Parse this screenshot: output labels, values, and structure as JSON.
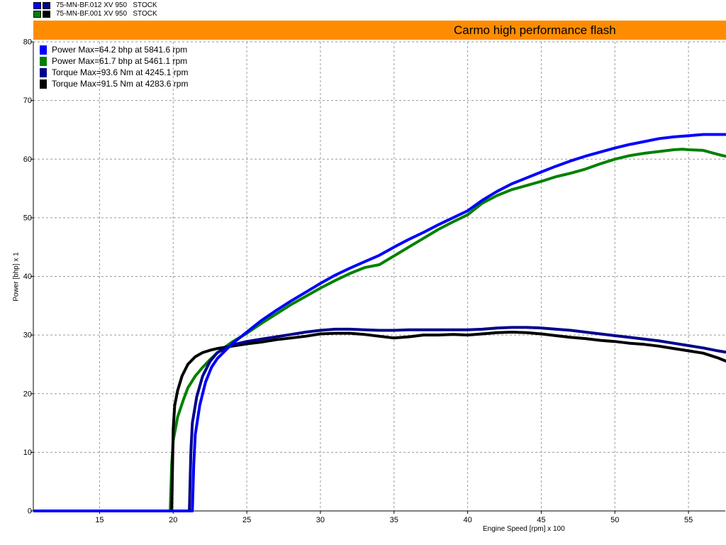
{
  "header": {
    "files": [
      {
        "label": "75-MN-BF.012 XV 950   STOCK",
        "color1": "#0000ff",
        "color2": "#00008b"
      },
      {
        "label": "75-MN-BF.001 XV 950   STOCK",
        "color1": "#008000",
        "color2": "#000000"
      }
    ],
    "banner_color": "#ff8c00"
  },
  "chart_data": {
    "type": "line",
    "title": "Carmo high performance flash",
    "xlabel": "Engine Speed [rpm] x 100",
    "ylabel": "Power [bhp] x 1",
    "xlim": [
      10.5,
      57.5
    ],
    "ylim": [
      0,
      80
    ],
    "x_ticks": [
      15,
      20,
      25,
      30,
      35,
      40,
      45,
      50,
      55
    ],
    "y_ticks": [
      0,
      10,
      20,
      30,
      40,
      50,
      60,
      70,
      80
    ],
    "grid": true,
    "legend_position": "top-left",
    "series": [
      {
        "name": "Power  Max=64.2 bhp at 5841.6 rpm",
        "color": "#0000ff",
        "x": [
          10.5,
          21.3,
          21.4,
          21.5,
          21.8,
          22.2,
          22.6,
          23,
          24,
          25,
          26,
          27,
          28,
          29,
          30,
          31,
          32,
          33,
          34,
          35,
          36,
          37,
          38,
          39,
          40,
          41,
          42,
          43,
          44,
          45,
          46,
          47,
          48,
          49,
          50,
          51,
          52,
          53,
          54,
          55,
          56,
          57,
          57.5
        ],
        "y": [
          0,
          0,
          8,
          13,
          18,
          22,
          24.5,
          26,
          28.5,
          30.5,
          32.5,
          34.2,
          35.8,
          37.3,
          38.8,
          40.2,
          41.4,
          42.5,
          43.6,
          45,
          46.3,
          47.5,
          48.8,
          50,
          51.2,
          53,
          54.5,
          55.8,
          56.8,
          57.8,
          58.8,
          59.7,
          60.5,
          61.2,
          61.9,
          62.5,
          63,
          63.5,
          63.8,
          64,
          64.2,
          64.2,
          64.2
        ]
      },
      {
        "name": "Power  Max=61.7 bhp at 5461.1 rpm",
        "color": "#008000",
        "x": [
          10.5,
          19.8,
          19.9,
          20,
          20.3,
          20.7,
          21,
          21.5,
          22,
          22.5,
          23,
          24,
          25,
          26,
          27,
          28,
          29,
          30,
          31,
          32,
          33,
          34,
          35,
          36,
          37,
          38,
          39,
          40,
          41,
          42,
          43,
          44,
          45,
          46,
          47,
          48,
          49,
          50,
          51,
          52,
          53,
          54,
          54.6,
          55,
          56,
          57,
          57.5
        ],
        "y": [
          0,
          0,
          8,
          12,
          16,
          19,
          21,
          23,
          24.5,
          25.8,
          27,
          28.8,
          30.3,
          32,
          33.6,
          35.2,
          36.6,
          38,
          39.3,
          40.5,
          41.5,
          42,
          43.5,
          45,
          46.5,
          48,
          49.3,
          50.5,
          52.5,
          53.8,
          54.8,
          55.5,
          56.2,
          57,
          57.6,
          58.3,
          59.2,
          60,
          60.6,
          61,
          61.3,
          61.6,
          61.7,
          61.6,
          61.5,
          60.8,
          60.5
        ]
      },
      {
        "name": "Torque  Max=93.6 Nm at 4245.1 rpm",
        "color": "#00008b",
        "x": [
          10.5,
          21.1,
          21.2,
          21.3,
          21.6,
          22,
          22.5,
          23,
          24,
          25,
          26,
          27,
          28,
          29,
          30,
          31,
          32,
          33,
          34,
          35,
          36,
          37,
          38,
          39,
          40,
          41,
          42,
          43,
          44,
          45,
          46,
          47,
          48,
          49,
          50,
          51,
          52,
          53,
          54,
          55,
          56,
          57,
          57.5
        ],
        "y": [
          0,
          0,
          10,
          15,
          19.5,
          23,
          25.5,
          27,
          28.3,
          28.9,
          29.3,
          29.7,
          30.1,
          30.5,
          30.8,
          31,
          31,
          30.9,
          30.8,
          30.8,
          30.9,
          30.9,
          30.9,
          30.9,
          30.9,
          31,
          31.2,
          31.3,
          31.3,
          31.2,
          31,
          30.8,
          30.5,
          30.2,
          29.9,
          29.6,
          29.3,
          29,
          28.6,
          28.2,
          27.8,
          27.3,
          27.1
        ]
      },
      {
        "name": "Torque  Max=91.5 Nm at 4283.6 rpm",
        "color": "#000000",
        "x": [
          10.5,
          19.9,
          20,
          20.1,
          20.3,
          20.6,
          21,
          21.5,
          22,
          22.5,
          23,
          24,
          25,
          26,
          27,
          28,
          29,
          30,
          31,
          32,
          33,
          34,
          35,
          36,
          37,
          38,
          39,
          40,
          41,
          42,
          43,
          44,
          45,
          46,
          47,
          48,
          49,
          50,
          51,
          52,
          53,
          54,
          55,
          56,
          57,
          57.5
        ],
        "y": [
          0,
          0,
          14,
          18,
          20.5,
          23,
          25,
          26.3,
          27,
          27.4,
          27.7,
          28.1,
          28.5,
          28.8,
          29.2,
          29.5,
          29.8,
          30.2,
          30.3,
          30.3,
          30.1,
          29.8,
          29.5,
          29.7,
          30,
          30,
          30.1,
          30,
          30.2,
          30.4,
          30.5,
          30.4,
          30.2,
          29.9,
          29.6,
          29.4,
          29.1,
          28.9,
          28.6,
          28.4,
          28.1,
          27.7,
          27.3,
          26.9,
          26.1,
          25.6
        ]
      }
    ]
  }
}
